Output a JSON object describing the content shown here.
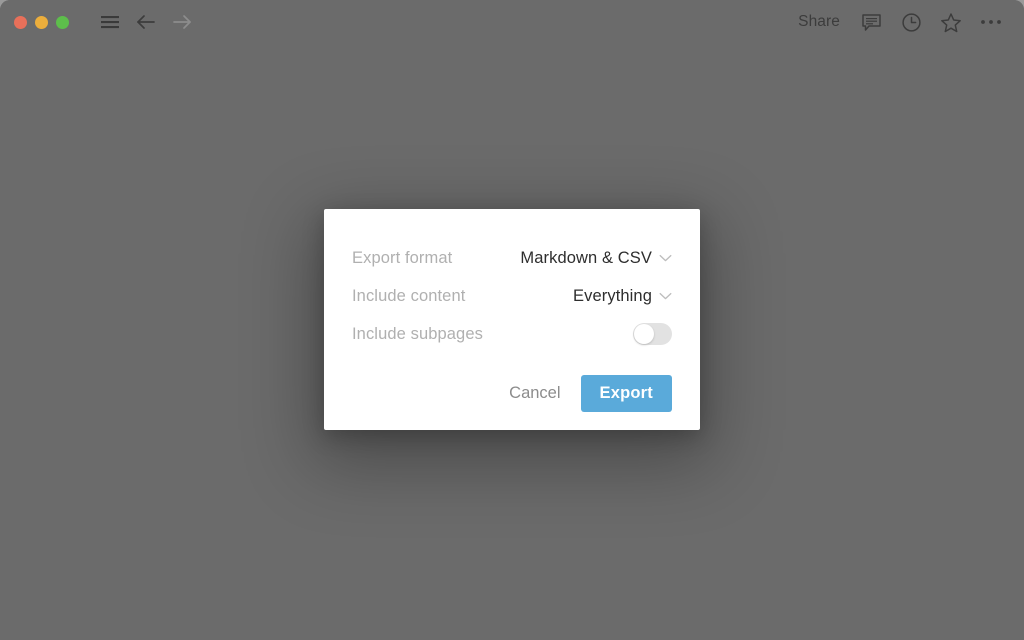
{
  "window": {
    "background_color": "#6b6b6b",
    "traffic_lights": [
      {
        "name": "close",
        "color": "#e8705a"
      },
      {
        "name": "minimize",
        "color": "#ecae3c"
      },
      {
        "name": "maximize",
        "color": "#5dbe4b"
      }
    ],
    "nav": [
      {
        "icon": "menu-icon",
        "state": "enabled"
      },
      {
        "icon": "arrow-left-icon",
        "state": "enabled"
      },
      {
        "icon": "arrow-right-icon",
        "state": "disabled"
      }
    ]
  },
  "toolbar": {
    "share_label": "Share",
    "icons": [
      {
        "icon": "comment-icon"
      },
      {
        "icon": "clock-icon"
      },
      {
        "icon": "star-icon"
      },
      {
        "icon": "ellipsis-icon"
      }
    ]
  },
  "dialog": {
    "accent_color": "#5aaada",
    "rows": [
      {
        "label": "Export format",
        "value": "Markdown & CSV",
        "control": "dropdown",
        "chevron": "chevron-down-icon"
      },
      {
        "label": "Include content",
        "value": "Everything",
        "control": "dropdown",
        "chevron": "chevron-down-icon"
      },
      {
        "label": "Include subpages",
        "control": "toggle",
        "toggle_state": "off"
      }
    ],
    "cancel_label": "Cancel",
    "export_label": "Export"
  }
}
